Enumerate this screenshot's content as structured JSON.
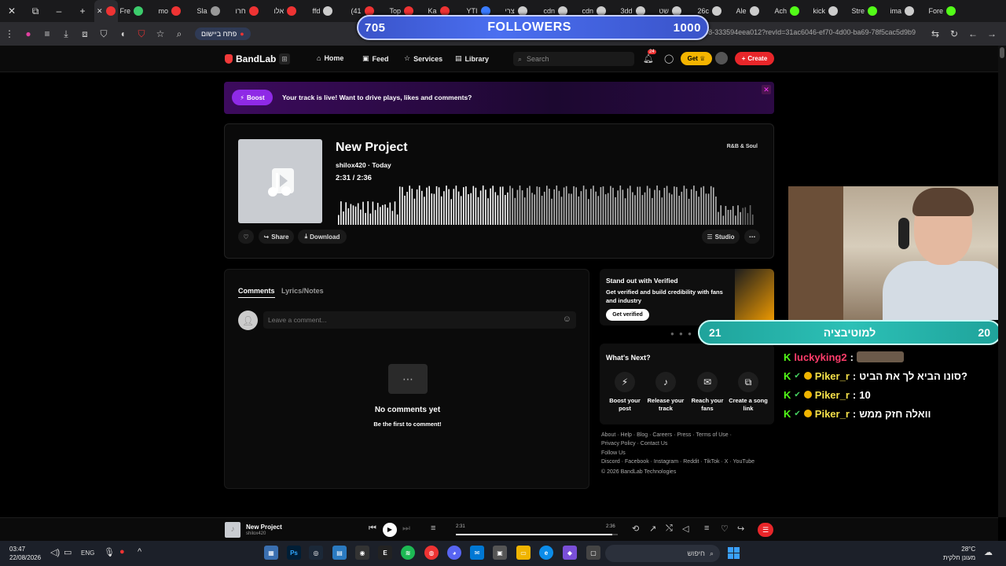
{
  "browser": {
    "tabs": [
      {
        "label": "Fre",
        "color": "#3ccc6c"
      },
      {
        "label": "mo",
        "color": "#e33"
      },
      {
        "label": "Sla",
        "color": "#999"
      },
      {
        "label": "חרו",
        "color": "#e33"
      },
      {
        "label": "אלו",
        "color": "#e33"
      },
      {
        "label": "ffd",
        "color": "#ccc"
      },
      {
        "label": "(41",
        "color": "#e33"
      },
      {
        "label": "Top",
        "color": "#e33"
      },
      {
        "label": "Ka",
        "color": "#e33"
      },
      {
        "label": "YTI",
        "color": "#3a7bff"
      },
      {
        "label": "צרי",
        "color": "#ccc"
      },
      {
        "label": "cdn",
        "color": "#ccc"
      },
      {
        "label": "cdn",
        "color": "#ccc"
      },
      {
        "label": "3dd",
        "color": "#ccc"
      },
      {
        "label": "שט",
        "color": "#ccc"
      },
      {
        "label": "26c",
        "color": "#ccc"
      },
      {
        "label": "Ale",
        "color": "#ccc"
      },
      {
        "label": "Ach",
        "color": "#53fc18"
      },
      {
        "label": "kick",
        "color": "#ccc"
      },
      {
        "label": "Stre",
        "color": "#53fc18"
      },
      {
        "label": "ima",
        "color": "#ccc"
      },
      {
        "label": "Fore",
        "color": "#53fc18"
      }
    ],
    "open_in_app": "פתח ביישום",
    "url": "om/track/d445a80f-4fa1-4ea9-9a68-333594eea012?revId=31ac6046-ef70-4d00-ba69-78f5cac5d9b9"
  },
  "followers": {
    "current": "705",
    "label": "FOLLOWERS",
    "goal": "1000",
    "progress": 0.705
  },
  "nav": {
    "brand": "BandLab",
    "home": "Home",
    "feed": "Feed",
    "services": "Services",
    "library": "Library",
    "search_placeholder": "Search",
    "notif_count": "24",
    "get": "Get",
    "create": "Create"
  },
  "boost": {
    "button": "Boost",
    "text": "Your track is live! Want to drive plays, likes and comments?"
  },
  "track": {
    "title": "New Project",
    "user": "shilox420",
    "when": "Today",
    "elapsed": "2:31",
    "duration": "2:36",
    "genre": "R&B & Soul",
    "played_fraction": 0.968,
    "share": "Share",
    "download": "Download",
    "studio": "Studio"
  },
  "comments": {
    "tab_comments": "Comments",
    "tab_lyrics": "Lyrics/Notes",
    "placeholder": "Leave a comment...",
    "empty_title": "No comments yet",
    "empty_sub": "Be the first to comment!"
  },
  "verified": {
    "title": "Stand out with Verified",
    "desc": "Get verified and build credibility with fans and industry",
    "button": "Get verified"
  },
  "whats_next": {
    "title": "What's Next?",
    "items": [
      {
        "label": "Boost your post",
        "icon": "bolt-icon"
      },
      {
        "label": "Release your track",
        "icon": "release-icon"
      },
      {
        "label": "Reach your fans",
        "icon": "mail-icon"
      },
      {
        "label": "Create a song link",
        "icon": "link-icon"
      }
    ]
  },
  "footer": {
    "line1": "About · Help · Blog · Careers · Press · Terms of Use ·",
    "line2": "Privacy Policy · Contact Us",
    "follow": "Follow Us",
    "socials": "Discord · Facebook · Instagram · Reddit · TikTok · X · YouTube",
    "copyright": "© 2026 BandLab Technologies"
  },
  "motivation": {
    "left": "21",
    "label": "למוטיבציה",
    "right": "20"
  },
  "chat": [
    {
      "user": "luckyking2",
      "text": "",
      "user_color": "#ff3d6b",
      "badges": false
    },
    {
      "user": "Piker_r",
      "text": "סונו הביא לך את הביט?",
      "user_color": "#f5e04a",
      "badges": true
    },
    {
      "user": "Piker_r",
      "text": "10",
      "user_color": "#f5e04a",
      "badges": true
    },
    {
      "user": "Piker_r",
      "text": "וואלה חזק ממש",
      "user_color": "#f5e04a",
      "badges": true
    }
  ],
  "player": {
    "title": "New Project",
    "user": "shilox420",
    "elapsed": "2:31",
    "duration": "2:36",
    "progress": 0.968
  },
  "taskbar": {
    "time": "03:47",
    "date": "22/08/2026",
    "lang": "ENG",
    "search": "חיפוש",
    "temp": "28°C",
    "weather": "מעונן חלקית"
  }
}
